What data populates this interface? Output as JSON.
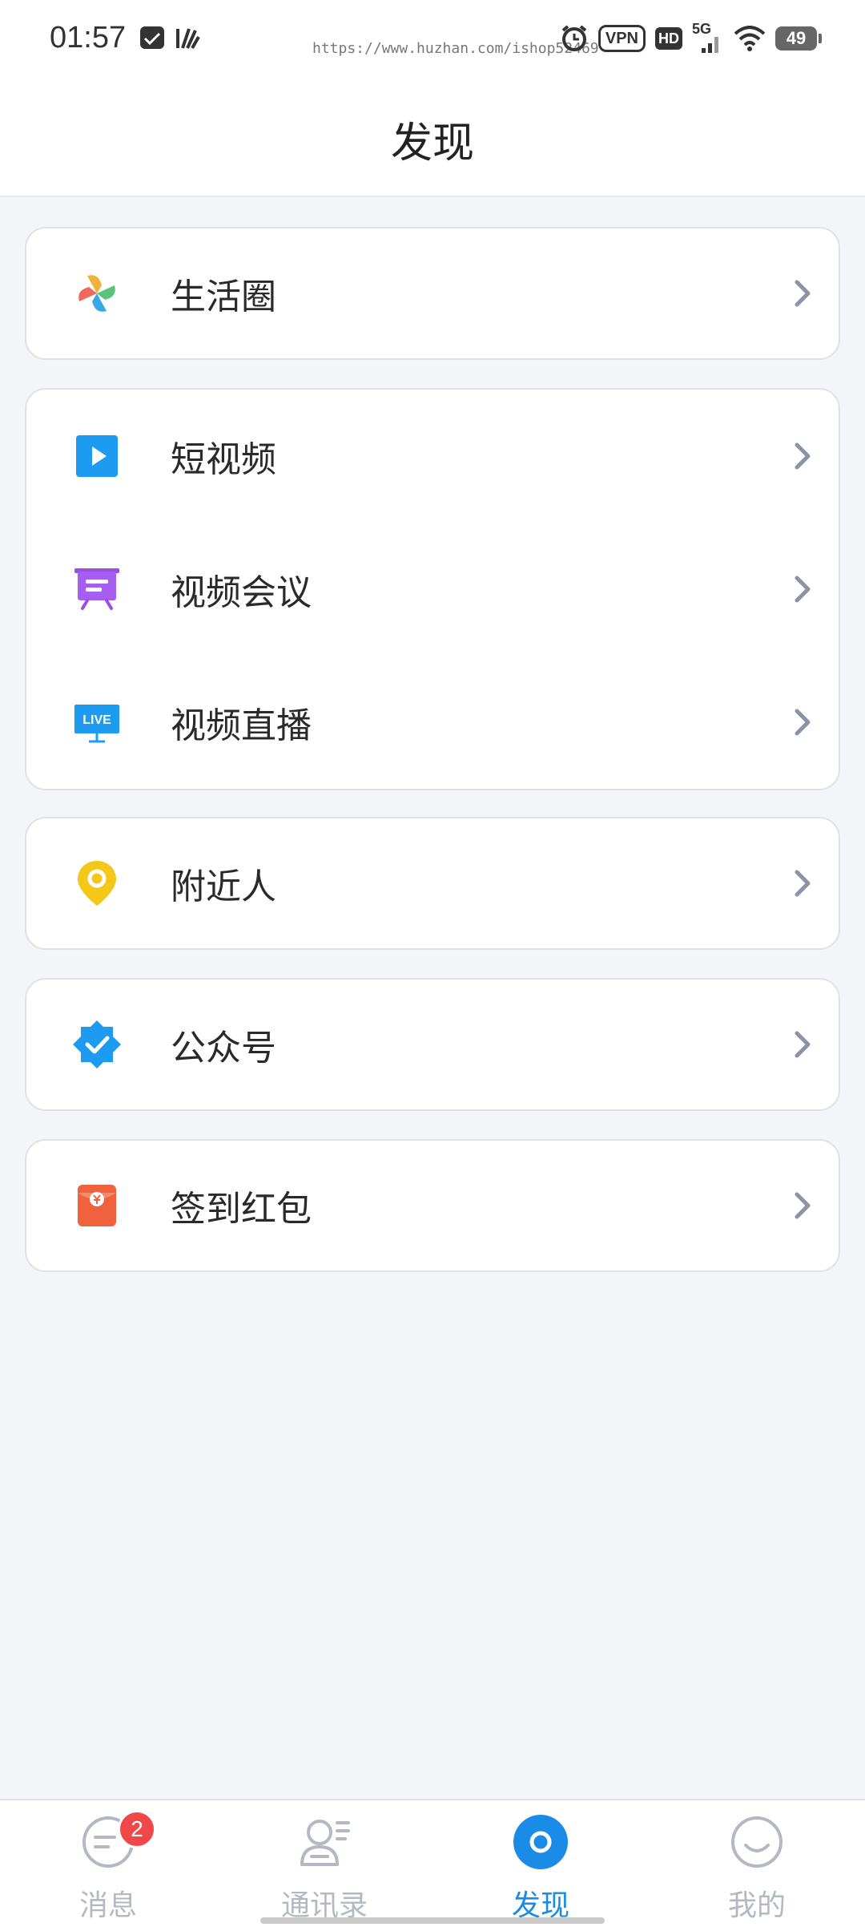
{
  "status_bar": {
    "time": "01:57",
    "url": "https://www.huzhan.com/ishop52469",
    "vpn": "VPN",
    "hd": "HD",
    "network": "5G",
    "battery": "49"
  },
  "header": {
    "title": "发现"
  },
  "groups": [
    {
      "items": [
        {
          "label": "生活圈",
          "icon": "pinwheel-icon"
        }
      ]
    },
    {
      "items": [
        {
          "label": "短视频",
          "icon": "play-icon"
        },
        {
          "label": "视频会议",
          "icon": "meeting-screen-icon"
        },
        {
          "label": "视频直播",
          "icon": "live-icon"
        }
      ]
    },
    {
      "items": [
        {
          "label": "附近人",
          "icon": "location-pin-icon"
        }
      ]
    },
    {
      "items": [
        {
          "label": "公众号",
          "icon": "verified-badge-icon"
        }
      ]
    },
    {
      "items": [
        {
          "label": "签到红包",
          "icon": "red-envelope-icon"
        }
      ]
    }
  ],
  "live_icon_text": "LIVE",
  "bottom_nav": {
    "tabs": [
      {
        "label": "消息",
        "icon": "message-icon",
        "badge": "2",
        "active": false
      },
      {
        "label": "通讯录",
        "icon": "contacts-icon",
        "active": false
      },
      {
        "label": "发现",
        "icon": "discover-icon",
        "active": true
      },
      {
        "label": "我的",
        "icon": "profile-icon",
        "active": false
      }
    ]
  },
  "colors": {
    "accent": "#1a8be6",
    "background": "#f4f5f9",
    "badge": "#f04848"
  }
}
